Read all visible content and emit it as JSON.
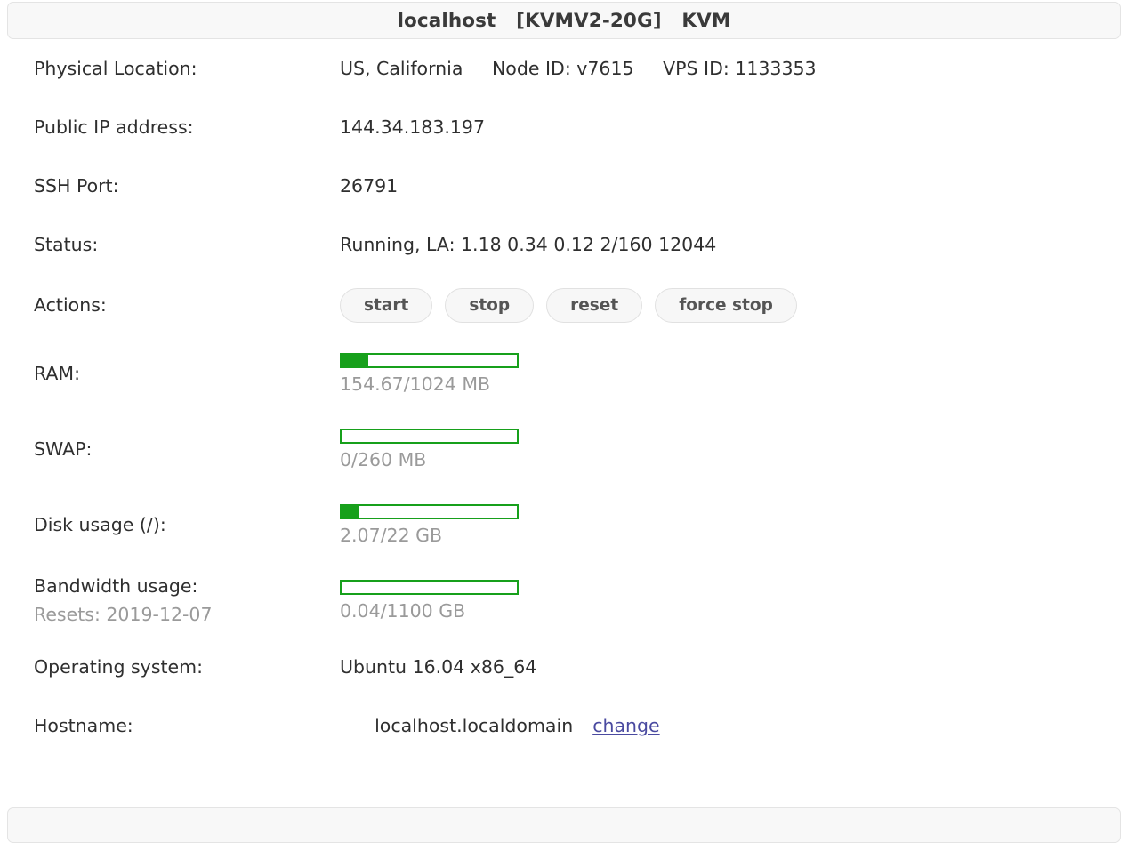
{
  "header": {
    "title": "localhost   [KVMV2-20G]   KVM"
  },
  "rows": {
    "physical_location": {
      "label": "Physical Location:",
      "value": "US, California     Node ID: v7615     VPS ID: 1133353"
    },
    "public_ip": {
      "label": "Public IP address:",
      "value": "144.34.183.197"
    },
    "ssh_port": {
      "label": "SSH Port:",
      "value": "26791"
    },
    "status": {
      "label": "Status:",
      "value": "Running, LA: 1.18 0.34 0.12 2/160 12044"
    },
    "actions": {
      "label": "Actions:",
      "buttons": [
        {
          "name": "start",
          "label": "start"
        },
        {
          "name": "stop",
          "label": "stop"
        },
        {
          "name": "reset",
          "label": "reset"
        },
        {
          "name": "force-stop",
          "label": "force stop"
        }
      ]
    },
    "ram": {
      "label": "RAM:",
      "text": "154.67/1024 MB",
      "used": 154.67,
      "total": 1024,
      "unit": "MB",
      "percent": 15.1
    },
    "swap": {
      "label": "SWAP:",
      "text": "0/260 MB",
      "used": 0,
      "total": 260,
      "unit": "MB",
      "percent": 0
    },
    "disk": {
      "label": "Disk usage (/):",
      "text": "2.07/22 GB",
      "used": 2.07,
      "total": 22,
      "unit": "GB",
      "percent": 9.4
    },
    "bandwidth": {
      "label": "Bandwidth usage:",
      "sub_label": "Resets: 2019-12-07",
      "text": "0.04/1100 GB",
      "used": 0.04,
      "total": 1100,
      "unit": "GB",
      "percent": 0
    },
    "operating_system": {
      "label": "Operating system:",
      "value": "Ubuntu 16.04 x86_64"
    },
    "hostname": {
      "label": "Hostname:",
      "value": "localhost.localdomain",
      "link_label": "change"
    }
  },
  "colors": {
    "meter_green": "#17a01b",
    "link": "#4a4aa0",
    "muted_text": "#9a9a9a",
    "panel_bg": "#f8f8f8",
    "panel_border": "#e4e4e4"
  }
}
